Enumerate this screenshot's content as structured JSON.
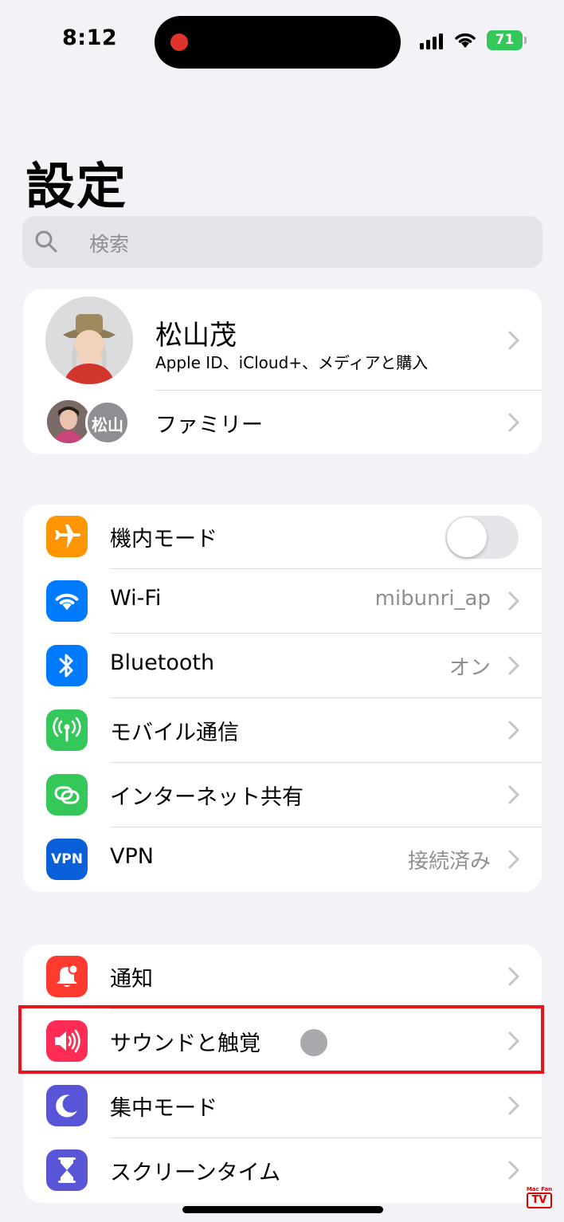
{
  "status_bar": {
    "time": "8:12",
    "battery": "71"
  },
  "page": {
    "title": "設定"
  },
  "search": {
    "placeholder": "検索"
  },
  "profile": {
    "name": "松山茂",
    "subtitle": "Apple ID、iCloud+、メディアと購入",
    "family_label": "ファミリー",
    "family_badge": "松山"
  },
  "connectivity": {
    "items": [
      {
        "label": "機内モード",
        "icon": "airplane-icon",
        "color": "#ff9500",
        "toggle": false
      },
      {
        "label": "Wi-Fi",
        "icon": "wifi-icon",
        "color": "#007aff",
        "value": "mibunri_ap"
      },
      {
        "label": "Bluetooth",
        "icon": "bluetooth-icon",
        "color": "#007aff",
        "value": "オン"
      },
      {
        "label": "モバイル通信",
        "icon": "antenna-icon",
        "color": "#34c759"
      },
      {
        "label": "インターネット共有",
        "icon": "link-icon",
        "color": "#34c759"
      },
      {
        "label": "VPN",
        "icon": "vpn-icon",
        "color": "#0a60d8",
        "value": "接続済み",
        "icon_text": "VPN"
      }
    ]
  },
  "notifications": {
    "items": [
      {
        "label": "通知",
        "icon": "bell-icon",
        "color": "#ff3b30"
      },
      {
        "label": "サウンドと触覚",
        "icon": "speaker-icon",
        "color": "#ff2d55",
        "highlighted": true
      },
      {
        "label": "集中モード",
        "icon": "moon-icon",
        "color": "#5856d6"
      },
      {
        "label": "スクリーンタイム",
        "icon": "hourglass-icon",
        "color": "#5856d6"
      }
    ]
  },
  "watermark": {
    "top": "Mac Fan",
    "bottom": "TV"
  }
}
